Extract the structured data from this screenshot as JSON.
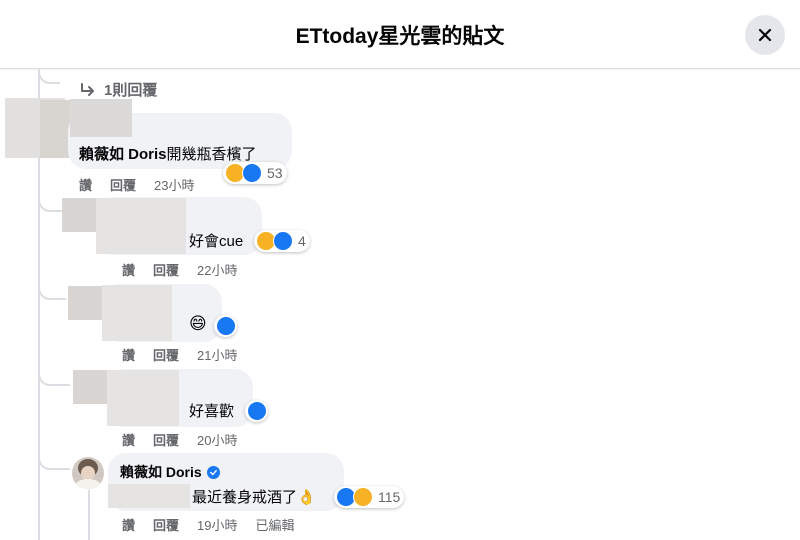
{
  "header": {
    "title": "ETtoday星光雲的貼文"
  },
  "replies_link": {
    "label": "1則回覆"
  },
  "comments": [
    {
      "tag": "賴薇如 Doris",
      "text": "開幾瓶香檳了",
      "reaction_count": "53",
      "actions": {
        "like": "讚",
        "reply": "回覆",
        "time": "23小時"
      }
    },
    {
      "text": "好會cue",
      "reaction_count": "4",
      "actions": {
        "like": "讚",
        "reply": "回覆",
        "time": "22小時"
      }
    },
    {
      "text": "😄",
      "actions": {
        "like": "讚",
        "reply": "回覆",
        "time": "21小時"
      }
    },
    {
      "text": "好喜歡",
      "actions": {
        "like": "讚",
        "reply": "回覆",
        "time": "20小時"
      }
    },
    {
      "author": "賴薇如 Doris",
      "text": "最近養身戒酒了👌",
      "reaction_count": "115",
      "actions": {
        "like": "讚",
        "reply": "回覆",
        "time": "19小時",
        "edited": "已編輯"
      }
    }
  ],
  "icons": [
    "close-icon",
    "reply-arrow-icon",
    "like-reaction-icon",
    "haha-reaction-icon",
    "verified-badge-icon"
  ],
  "colors": {
    "like": "#1877f2",
    "haha": "#f7b125",
    "bubble": "#f0f2f5",
    "muted": "#65676b"
  }
}
